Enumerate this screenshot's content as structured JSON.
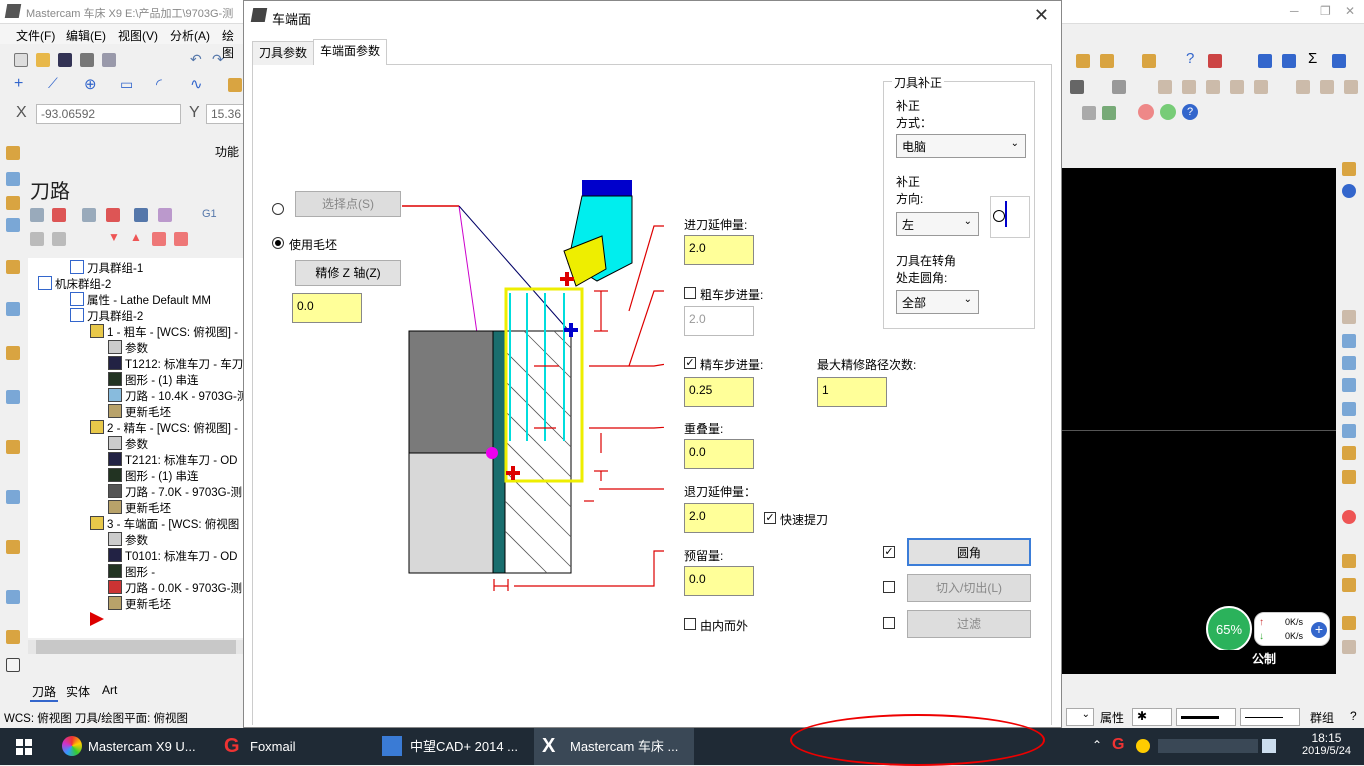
{
  "app": {
    "title": "Mastercam 车床 X9  E:\\产品加工\\9703G-测",
    "menu": [
      "文件(F)",
      "编辑(E)",
      "视图(V)",
      "分析(A)",
      "绘图"
    ],
    "x_label": "X",
    "x_value": "-93.06592",
    "y_label": "Y",
    "y_value": "15.36",
    "function_label": "功能",
    "panel_title": "刀路",
    "tree": [
      "刀具群组-1",
      "机床群组-2",
      "属性 - Lathe Default MM",
      "刀具群组-2",
      "1 - 粗车 - [WCS: 俯视图] -",
      "参数",
      "T1212: 标准车刀 - 车刀",
      "图形 - (1) 串连",
      "刀路 - 10.4K - 9703G-测",
      "更新毛坯",
      "2 - 精车 - [WCS: 俯视图] -",
      "参数",
      "T2121: 标准车刀 - OD",
      "图形 - (1) 串连",
      "刀路 - 7.0K - 9703G-测",
      "更新毛坯",
      "3 - 车端面 - [WCS: 俯视图",
      "参数",
      "T0101: 标准车刀 - OD",
      "图形 -",
      "刀路 - 0.0K - 9703G-测",
      "更新毛坯"
    ],
    "bottom_tabs": [
      "刀路",
      "实体",
      "Art"
    ],
    "status": "WCS: 俯视图  刀具/绘图平面: 俯视图",
    "right_status": {
      "props": "属性",
      "layer": "群组",
      "gauge": "65%",
      "up_speed": "0K/s",
      "down_speed": "0K/s",
      "unit": "公制"
    }
  },
  "dialog": {
    "title": "车端面",
    "tabs": [
      "刀具参数",
      "车端面参数"
    ],
    "select_point": "选择点(S)",
    "use_stock": "使用毛坯",
    "finish_z": "精修 Z 轴(Z)",
    "finish_z_value": "0.0",
    "entry_amount_label": "进刀延伸量:",
    "entry_amount": "2.0",
    "rough_step_label": "粗车步进量:",
    "rough_step": "2.0",
    "finish_step_label": "精车步进量:",
    "finish_step": "0.25",
    "max_finish_passes_label": "最大精修路径次数:",
    "max_finish_passes": "1",
    "overlap_label": "重叠量:",
    "overlap": "0.0",
    "retract_amount_label": "退刀延伸量：",
    "retract_amount": "2.0",
    "rapid_retract": "快速提刀",
    "stock_to_leave_label": "预留量:",
    "stock_to_leave": "0.0",
    "inside_out": "由内而外",
    "comp_group_title": "刀具补正",
    "comp_type_label1": "补正",
    "comp_type_label2": "方式：",
    "comp_type": "电脑",
    "comp_dir_label1": "补正",
    "comp_dir_label2": "方向:",
    "comp_dir": "左",
    "corner_label1": "刀具在转角",
    "corner_label2": "处走圆角:",
    "corner": "全部",
    "btn_round": "圆角",
    "btn_lead": "切入/切出(L)",
    "btn_filter": "过滤"
  },
  "taskbar": {
    "items": [
      "Mastercam X9 U...",
      "Foxmail",
      "中望CAD+ 2014 ...",
      "Mastercam 车床 ..."
    ],
    "time": "18:15",
    "date": "2019/5/24"
  }
}
